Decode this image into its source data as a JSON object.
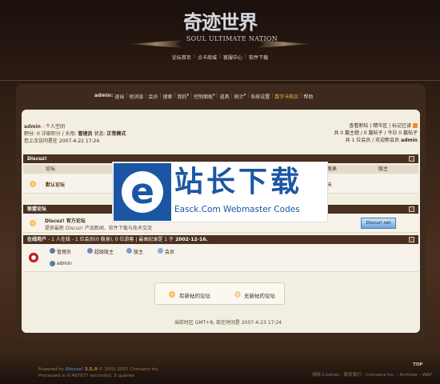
{
  "header": {
    "logo_main": "奇迹世界",
    "logo_sub": "SOUL ULTIMATE NATION",
    "nav": [
      "论坛首页",
      "点卡商城",
      "客服中心",
      "软件下载"
    ]
  },
  "menubar": {
    "items": [
      "admin:",
      "退出",
      "短消息",
      "会员",
      "搜索",
      "我的",
      "控制面板",
      "道具",
      "统计",
      "系统设置",
      "数字卡购买",
      "帮助"
    ]
  },
  "user": {
    "name": "admin",
    "space": "个人空间",
    "line2_prefix": "积分:",
    "credits": "0",
    "credits_link": "详细积分",
    "title_label": "头衔:",
    "title": "管理员",
    "status_label": "状态:",
    "status": "正常模式",
    "last_visit": "您上次访问是在 2007-4-22 17:24"
  },
  "quicklinks": {
    "items": [
      "查看新帖",
      "精华区",
      "标记已读"
    ],
    "stats_line1": "共 0 篇主题 / 0 篇帖子 / 今日 0 篇帖子",
    "stats_line2_prefix": "共 1 位会员 / 欢迎新会员",
    "newest_member": "admin"
  },
  "forum_section": {
    "title": "Discuz!",
    "col_forum": "论坛",
    "col_last": "发表",
    "col_mod": "版主",
    "forum_name": "默认论坛",
    "last_post_tail": "未"
  },
  "link_section": {
    "title": "联盟论坛",
    "site_name": "Discuz! 官方论坛",
    "site_desc": "提供最新 Discuz! 产品新闻、软件下载与技术交流",
    "badge": "Discuz!.net"
  },
  "online": {
    "title_prefix": "在线用户",
    "summary": "- 1 人在线 - 1 位会员(0 隐身), 0 位游客 | 最高纪录是 1 于",
    "record_date": "2002-12-16.",
    "legend": [
      "管理员",
      "超级版主",
      "版主",
      "会员"
    ],
    "user": "admin"
  },
  "legend_box": {
    "new": "有新帖的论坛",
    "none": "无新帖的论坛"
  },
  "timezone": "当前时区 GMT+8, 现在时间是 2007-4-23 17:24",
  "watermark": {
    "title": "站长下载",
    "subtitle": "Easck.Com Webmaster Codes",
    "letter": "e"
  },
  "footer": {
    "powered_prefix": "Powered by",
    "product": "Discuz!",
    "version": "5.5.0",
    "copyright": "© 2001-2007",
    "company": "Comsenz Inc.",
    "processed": "Processed in 0.497977 second(s), 5 queries",
    "top": "TOP",
    "links": "清除 Cookies - 联系我们 - Comsenz Inc. - Archiver - WAP"
  },
  "colors": {
    "panel": "#3d2a1d",
    "content": "#f3eee2",
    "bar": "#4a3020",
    "accent": "#f4b84a",
    "watermark_blue": "#1a56a4"
  }
}
